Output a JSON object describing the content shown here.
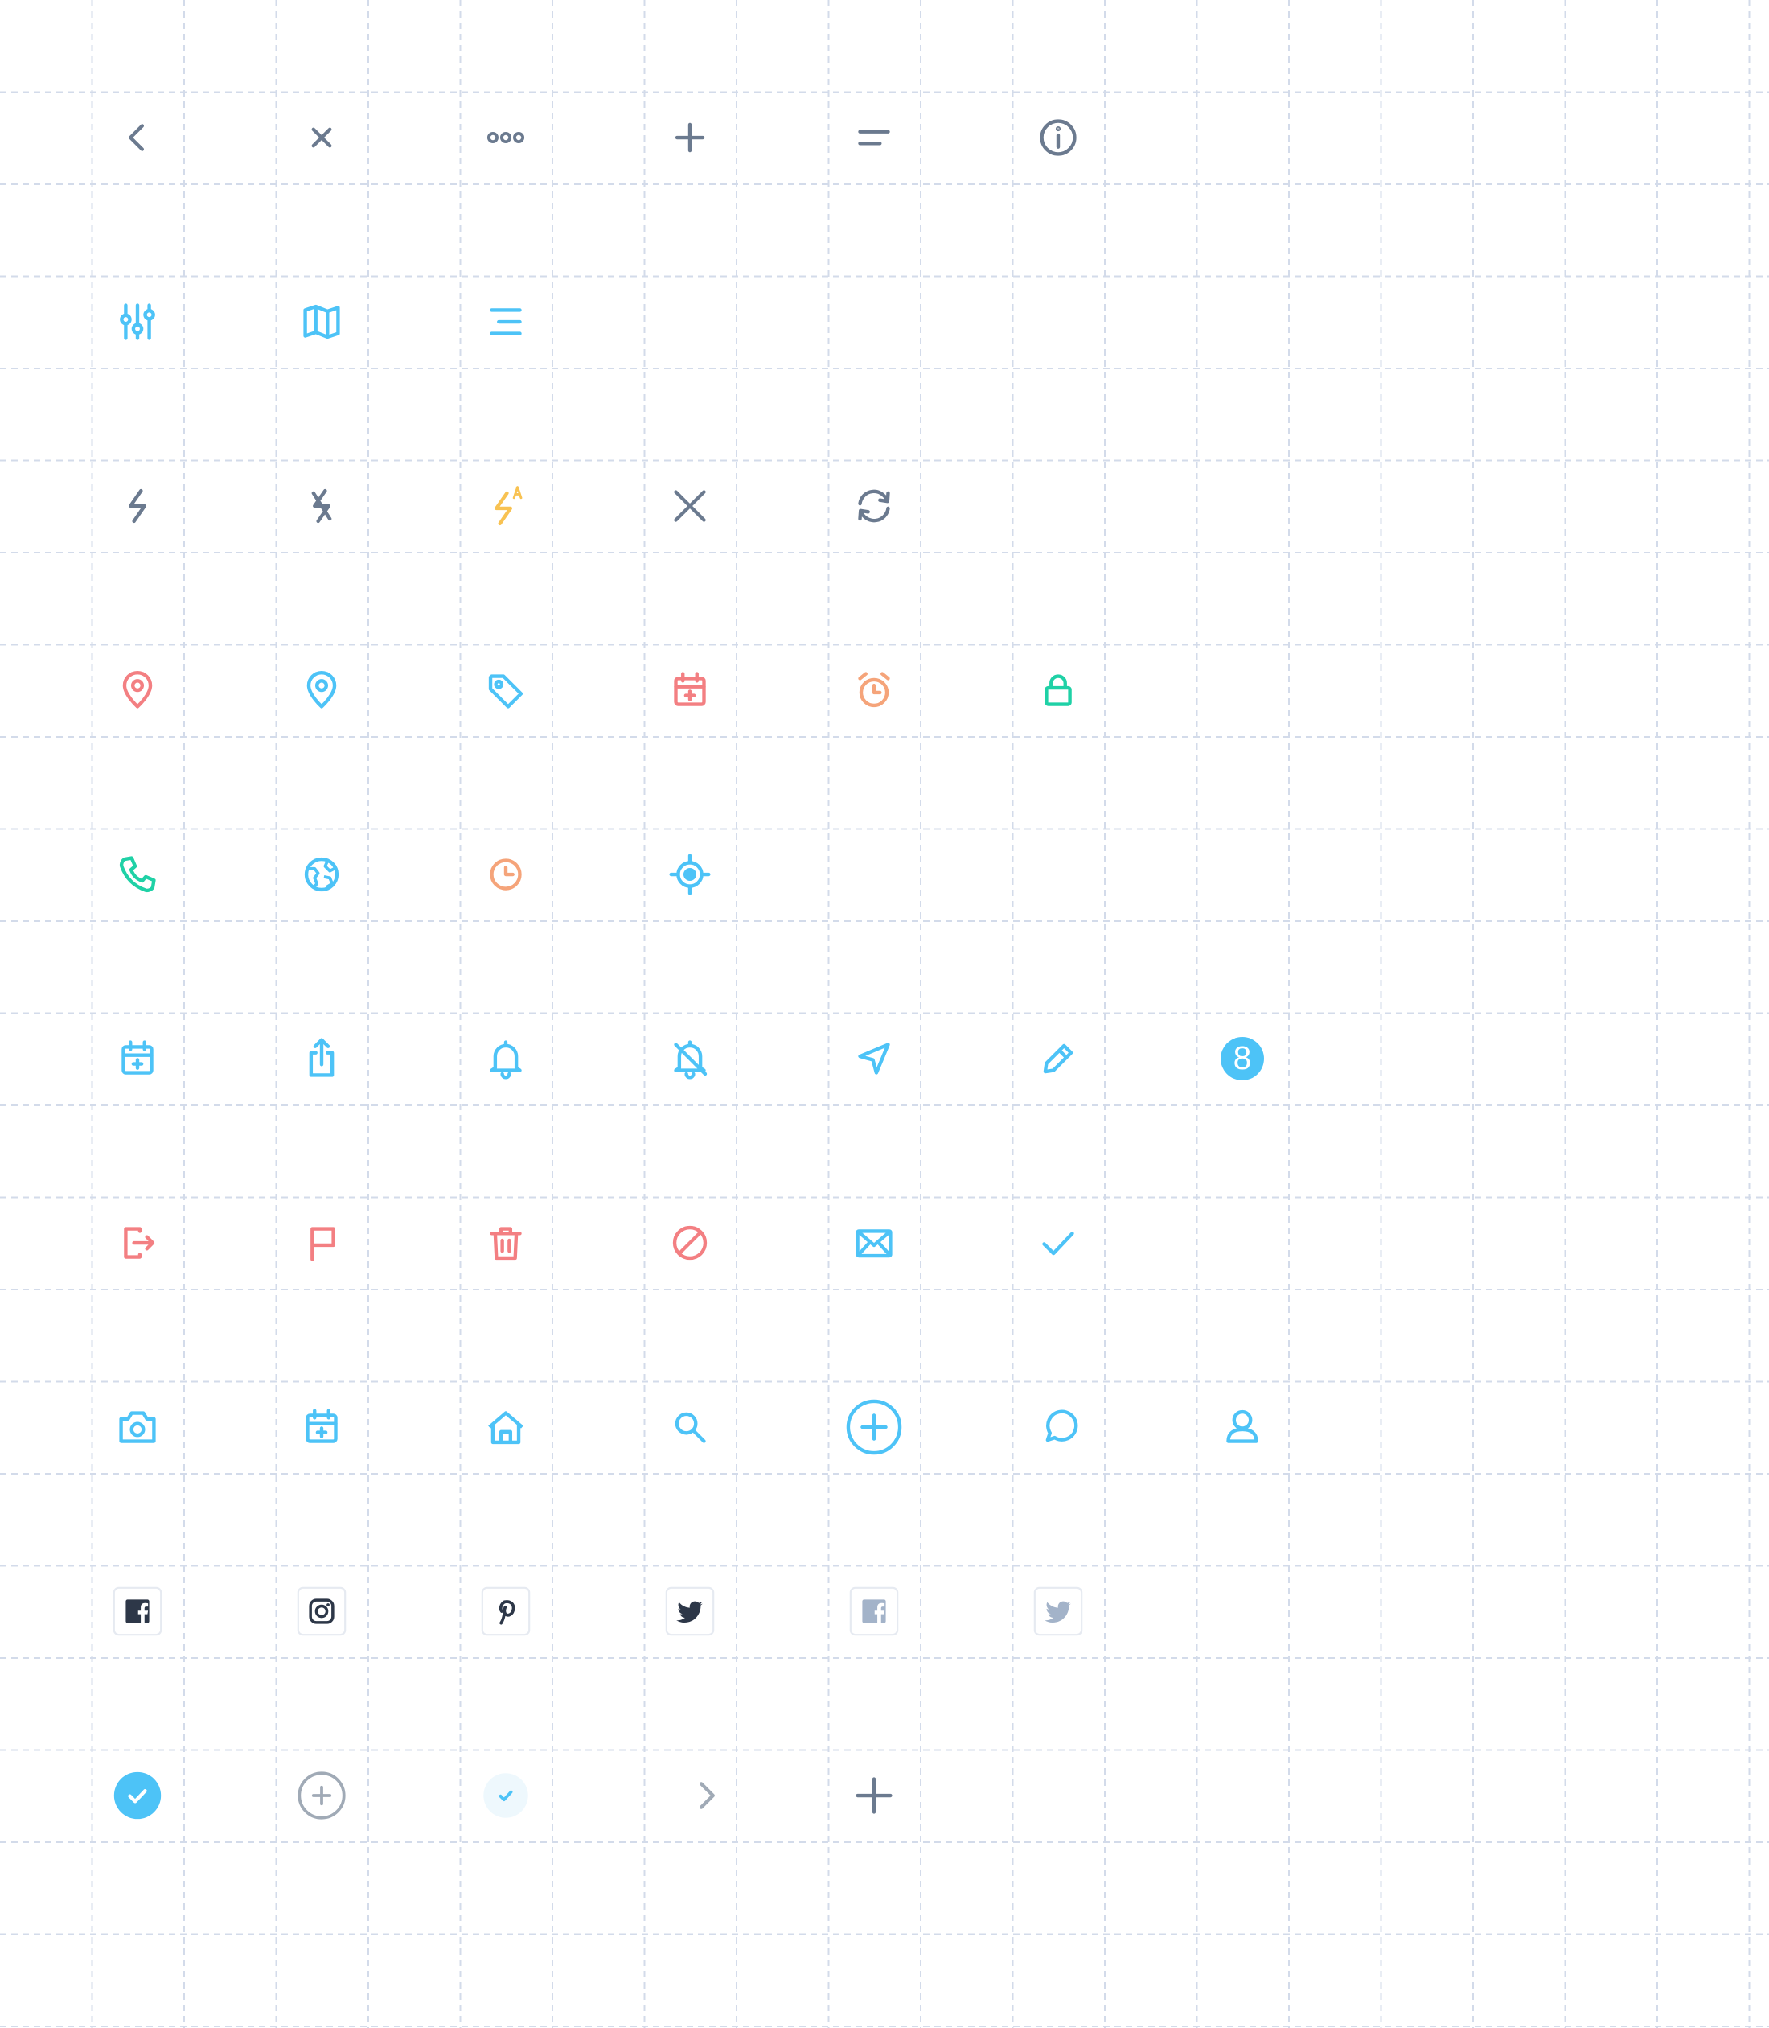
{
  "colors": {
    "grid_line": "#d3dbea",
    "gray": "#6b7a8f",
    "blue": "#4dc3f7",
    "red": "#f37f82",
    "orange": "#f5a47a",
    "yellow": "#f8c252",
    "green": "#1fd1a6",
    "dark": "#2d3748",
    "light_gray": "#a3b3c9",
    "circle_gray": "#a0aab6"
  },
  "rows": [
    {
      "icons": [
        "chevron-left-icon",
        "close-icon",
        "more-horizontal-icon",
        "plus-icon",
        "short-text-icon",
        "info-circle-icon"
      ]
    },
    {
      "icons": [
        "sliders-icon",
        "map-icon",
        "align-right-icon"
      ]
    },
    {
      "icons": [
        "flash-icon",
        "flash-off-icon",
        "flash-auto-icon",
        "close-large-icon",
        "refresh-icon"
      ]
    },
    {
      "icons": [
        "map-pin-icon",
        "map-pin-blue-icon",
        "tag-icon",
        "calendar-add-icon",
        "alarm-icon",
        "lock-icon"
      ]
    },
    {
      "icons": [
        "phone-icon",
        "globe-icon",
        "clock-icon",
        "locate-icon"
      ]
    },
    {
      "icons": [
        "calendar-add-icon",
        "share-icon",
        "bell-icon",
        "bell-off-icon",
        "navigation-icon",
        "edit-icon",
        "badge-icon"
      ]
    },
    {
      "icons": [
        "logout-icon",
        "flag-icon",
        "trash-icon",
        "block-icon",
        "mail-icon",
        "check-icon"
      ]
    },
    {
      "icons": [
        "camera-icon",
        "calendar-add-icon",
        "home-icon",
        "search-icon",
        "add-circle-icon",
        "chat-icon",
        "user-icon"
      ]
    },
    {
      "icons": [
        "facebook-icon",
        "instagram-icon",
        "pinterest-icon",
        "twitter-icon",
        "facebook-muted-icon",
        "twitter-muted-icon"
      ]
    },
    {
      "icons": [
        "check-circle-filled-icon",
        "add-circle-outline-icon",
        "check-circle-light-icon",
        "chevron-right-icon",
        "plus-large-icon"
      ]
    }
  ],
  "badge": {
    "count": "8"
  }
}
